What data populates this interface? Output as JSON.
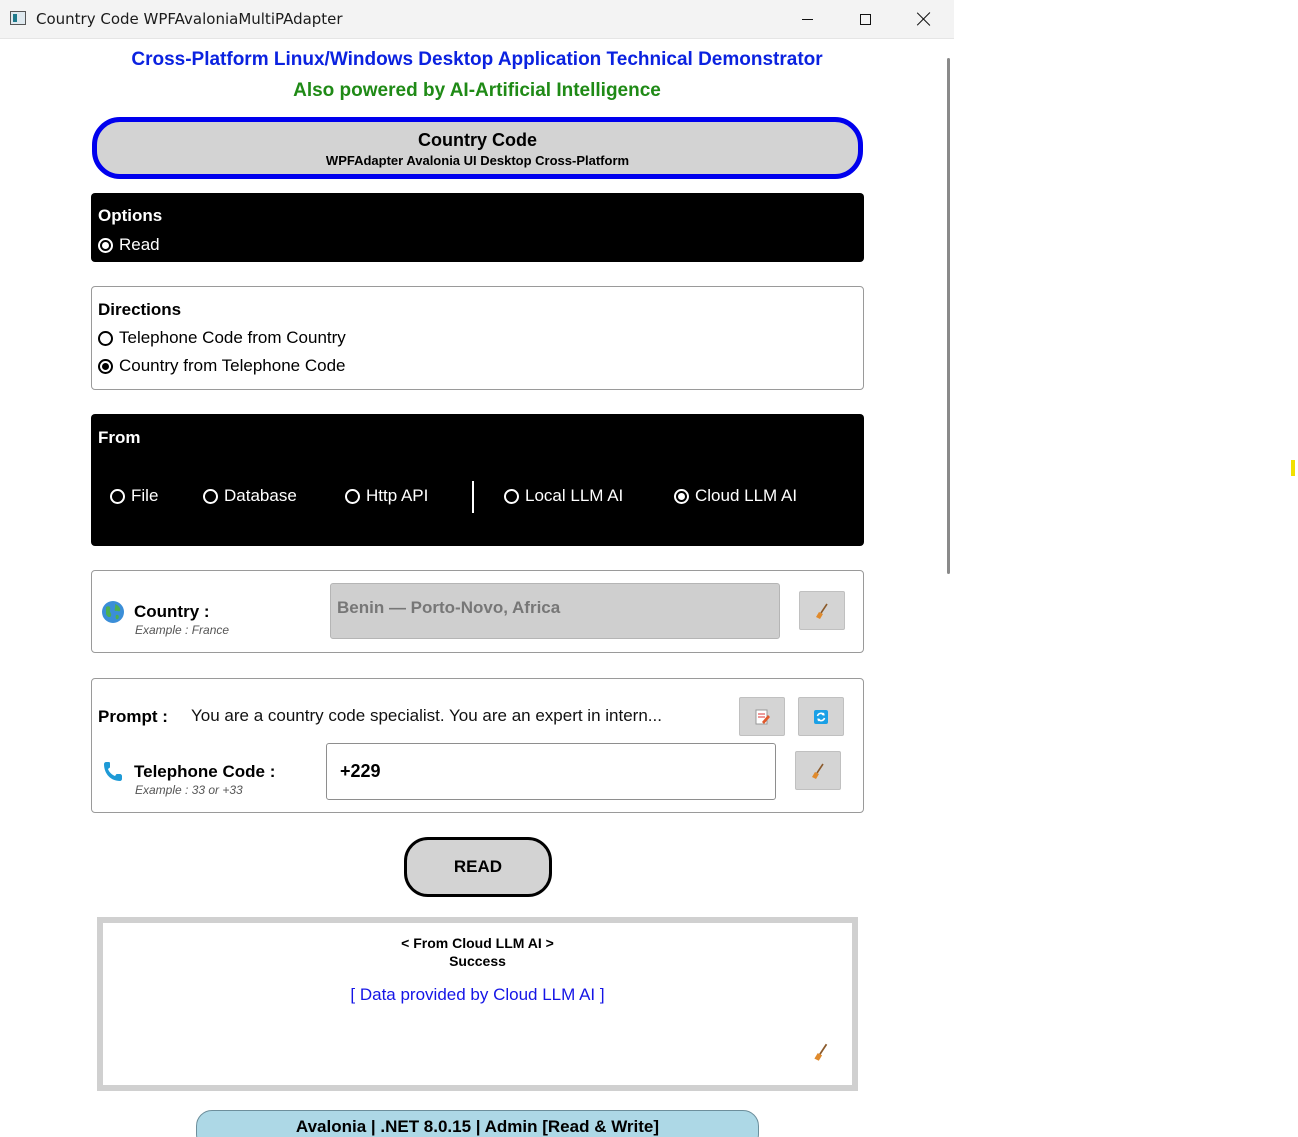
{
  "window": {
    "title": "Country Code WPFAvaloniaMultiPAdapter"
  },
  "headings": {
    "main": "Cross-Platform Linux/Windows Desktop Application Technical Demonstrator",
    "ai": "Also powered by AI-Artificial Intelligence"
  },
  "header": {
    "title": "Country Code",
    "subtitle": "WPFAdapter Avalonia UI Desktop Cross-Platform"
  },
  "options": {
    "label": "Options",
    "items": [
      {
        "label": "Read",
        "checked": true
      }
    ]
  },
  "directions": {
    "label": "Directions",
    "items": [
      {
        "label": "Telephone Code from Country",
        "checked": false
      },
      {
        "label": "Country from Telephone Code",
        "checked": true
      }
    ]
  },
  "from": {
    "label": "From",
    "items": [
      {
        "label": "File",
        "checked": false
      },
      {
        "label": "Database",
        "checked": false
      },
      {
        "label": "Http API",
        "checked": false
      },
      {
        "label": "Local LLM AI",
        "checked": false
      },
      {
        "label": "Cloud LLM AI",
        "checked": true
      }
    ]
  },
  "country": {
    "icon": "globe-icon",
    "label": "Country :",
    "example": "Example : France",
    "value": "Benin — Porto-Novo, Africa"
  },
  "prompt": {
    "label": "Prompt :",
    "value": "You are a country code specialist. You are an expert in intern..."
  },
  "telephone": {
    "icon": "telephone-icon",
    "label": "Telephone Code :",
    "example": "Example : 33 or +33",
    "value": "+229"
  },
  "actions": {
    "read_label": "READ"
  },
  "result": {
    "source": "< From Cloud LLM AI >",
    "status": "Success",
    "provided": "[ Data provided by Cloud LLM AI ]"
  },
  "footer": {
    "text": "Avalonia | .NET 8.0.15 | Admin [Read & Write]"
  },
  "colors": {
    "heading_blue": "#0b22e0",
    "heading_green": "#1f8a16",
    "header_border": "#0000ee",
    "footer_bg": "#add8e6"
  }
}
